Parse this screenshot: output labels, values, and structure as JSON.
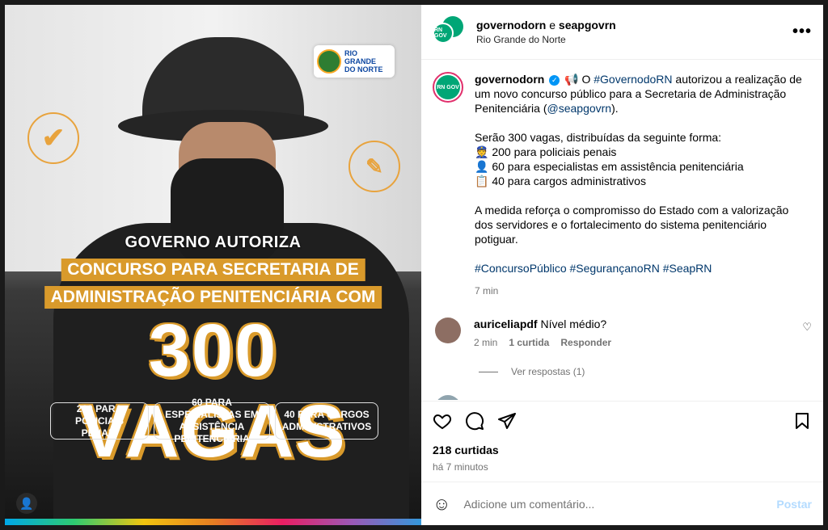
{
  "image": {
    "logo_text": "RIO GRANDE DO NORTE",
    "headline": "GOVERNO AUTORIZA",
    "band_1": "CONCURSO PARA SECRETARIA DE",
    "band_2": "ADMINISTRAÇÃO PENITENCIÁRIA COM",
    "big_number": "300 VAGAS",
    "pills": [
      "200 PARA POLICIAIS PENAIS",
      "60 PARA ESPECIALISTAS EM ASSISTÊNCIA PENITENCIÁRIA",
      "40 PARA CARGOS ADMINISTRATIVOS"
    ]
  },
  "header": {
    "user_1": "governodorn",
    "joiner": " e ",
    "user_2": "seapgovrn",
    "location": "Rio Grande do Norte",
    "avatar_label": "RN GOV"
  },
  "caption": {
    "user": "governodorn",
    "p1_a": " O ",
    "p1_tag": "#GovernodoRN",
    "p1_b": " autorizou a realização de um novo concurso público para a Secretaria de Administração Penitenciária (",
    "p1_mention": "@seapgovrn",
    "p1_c": ").",
    "p2_intro": "Serão 300 vagas, distribuídas da seguinte forma:",
    "p2_items": [
      "👮 200 para policiais penais",
      "👤 60 para especialistas em assistência penitenciária",
      "📋 40 para cargos administrativos"
    ],
    "p3": "A medida reforça o compromisso do Estado com a valorização dos servidores e o fortalecimento do sistema penitenciário potiguar.",
    "hashtags": "#ConcursoPúblico #SegurançanoRN #SeapRN",
    "time": "7 min"
  },
  "comment": {
    "user": "auriceliapdf",
    "text": "Nível médio?",
    "time": "2 min",
    "likes": "1 curtida",
    "reply": "Responder",
    "view_replies": "Ver respostas (1)"
  },
  "footer": {
    "likes": "218 curtidas",
    "posted": "há 7 minutos",
    "comment_placeholder": "Adicione um comentário...",
    "post_button": "Postar"
  }
}
